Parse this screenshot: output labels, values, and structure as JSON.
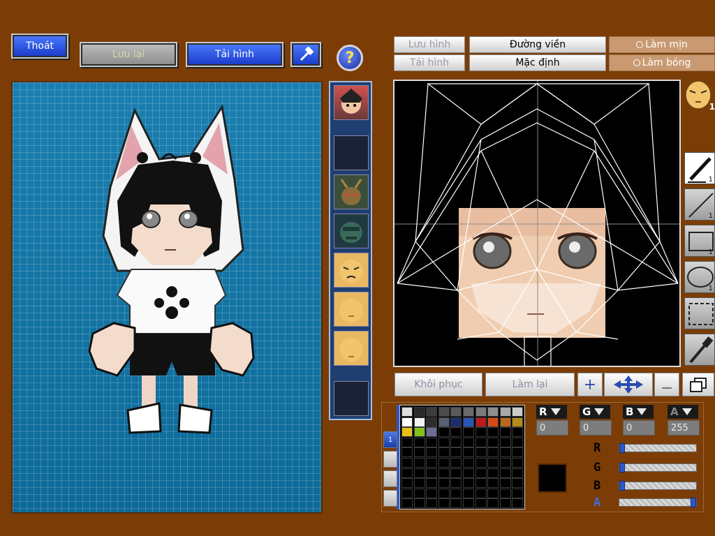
{
  "toolbar_left": {
    "exit_label": "Thoát",
    "save_label": "Lưu lại",
    "reload_label": "Tải hình",
    "help_symbol": "?",
    "hammer_icon": "hammer-icon"
  },
  "editor_top": {
    "save_image_label": "Lưu hình",
    "load_image_label": "Tải hình",
    "outline_label": "Đường viền",
    "default_label": "Mặc định",
    "smooth_label": "Làm mịn",
    "shine_label": "Làm bóng"
  },
  "thumbnails": [
    "ninja-face",
    "empty",
    "deer-mask",
    "green-mask",
    "frown-face",
    "plain-face",
    "smile-face",
    "empty"
  ],
  "face_badge_count": "1",
  "tools": [
    {
      "name": "pen-tool",
      "count": "1"
    },
    {
      "name": "line-tool",
      "count": "1"
    },
    {
      "name": "rectangle-tool",
      "count": "1"
    },
    {
      "name": "ellipse-tool",
      "count": "1"
    },
    {
      "name": "select-tool",
      "count": ""
    },
    {
      "name": "eyedropper-tool",
      "count": ""
    }
  ],
  "actions": {
    "restore_label": "Khôi phục",
    "redo_label": "Làm lại"
  },
  "palette_tab_label": "1",
  "palette_colors": [
    "#dddddd",
    "#2a2a2a",
    "#3c3c3c",
    "#4b4b4b",
    "#5a5a5a",
    "#6a6a6a",
    "#7b7b7b",
    "#8e8e8e",
    "#a8a8a8",
    "#cccccc",
    "#ffffff",
    "#f2f2f2",
    "#2d2d2d",
    "#556070",
    "#1b2d6d",
    "#2a56b8",
    "#c01818",
    "#d64a16",
    "#b86a18",
    "#b58a18",
    "#e4c21a",
    "#82c21c",
    "#6d6d9a"
  ],
  "color_channels": {
    "r_label": "R",
    "g_label": "G",
    "b_label": "B",
    "a_label": "A",
    "r_value": "0",
    "g_value": "0",
    "b_value": "0",
    "a_value": "255",
    "r": 0,
    "g": 0,
    "b": 0,
    "a": 255
  },
  "current_color": "#000000"
}
